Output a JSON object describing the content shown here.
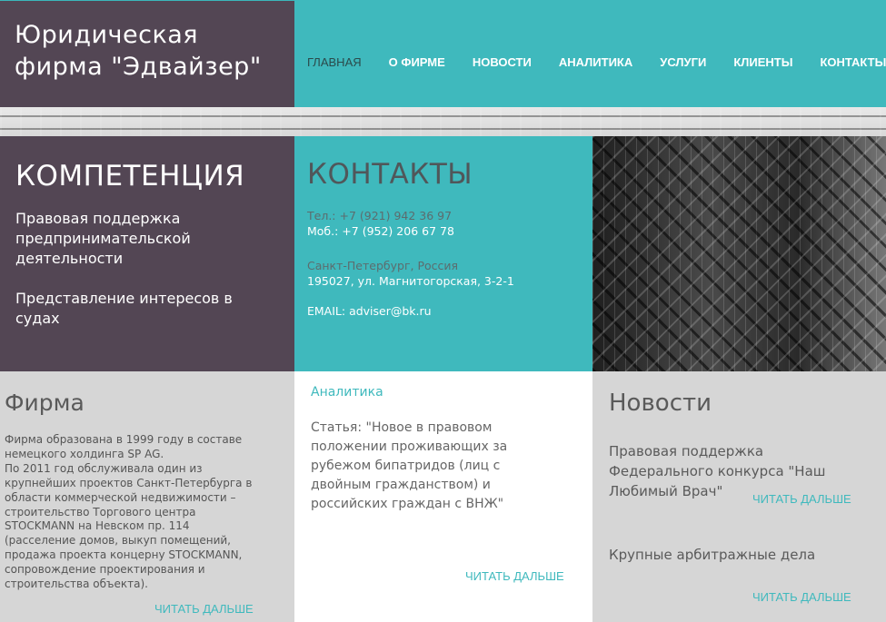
{
  "header": {
    "title": "Юридическая фирма \"Эдвайзер\"",
    "menu": [
      {
        "label": "ГЛАВНАЯ"
      },
      {
        "label": "О ФИРМЕ"
      },
      {
        "label": "НОВОСТИ"
      },
      {
        "label": "АНАЛИТИКА"
      },
      {
        "label": "УСЛУГИ"
      },
      {
        "label": "КЛИЕНТЫ"
      },
      {
        "label": "КОНТАКТЫ"
      }
    ]
  },
  "competence": {
    "title": "КОМПЕТЕНЦИЯ",
    "items": [
      "Правовая поддержка предпринимательской деятельности",
      "Представление интересов в судах"
    ]
  },
  "contacts": {
    "title": "КОНТАКТЫ",
    "phone": "Тел.:  +7 (921) 942 36 97",
    "mobile": "Моб.: +7 (952) 206 67 78",
    "city": "Санкт-Петербург, Россия",
    "address": "195027, ул. Магнитогорская, 3-2-1",
    "email": "EMAIL: adviser@bk.ru"
  },
  "firm": {
    "title": "Фирма",
    "text": "Фирма образована в 1999 году в составе немецкого холдинга SP AG.\nПо 2011 год обслуживала один из крупнейших проектов Санкт-Петербурга в области коммерческой недвижимости – строительство Торгового центра STOCKMANN на Невском пр. 114 (расселение домов, выкуп помещений, продажа проекта концерну STOCKMANN, сопровождение проектирования и строительства объекта).",
    "more": "ЧИТАТЬ ДАЛЬШЕ"
  },
  "analytics": {
    "title": "Аналитика",
    "text": "Статья: \"Новое в правовом положении проживающих за рубежом бипатридов (лиц с двойным гражданством) и российских граждан с ВНЖ\"",
    "more": "ЧИТАТЬ ДАЛЬШЕ"
  },
  "news": {
    "title": "Новости",
    "items": [
      {
        "text": "Правовая поддержка Федерального конкурса \"Наш Любимый Врач\"",
        "more": "ЧИТАТЬ ДАЛЬШЕ"
      },
      {
        "text": "Крупные арбитражные дела",
        "more": "ЧИТАТЬ ДАЛЬШЕ"
      }
    ]
  }
}
